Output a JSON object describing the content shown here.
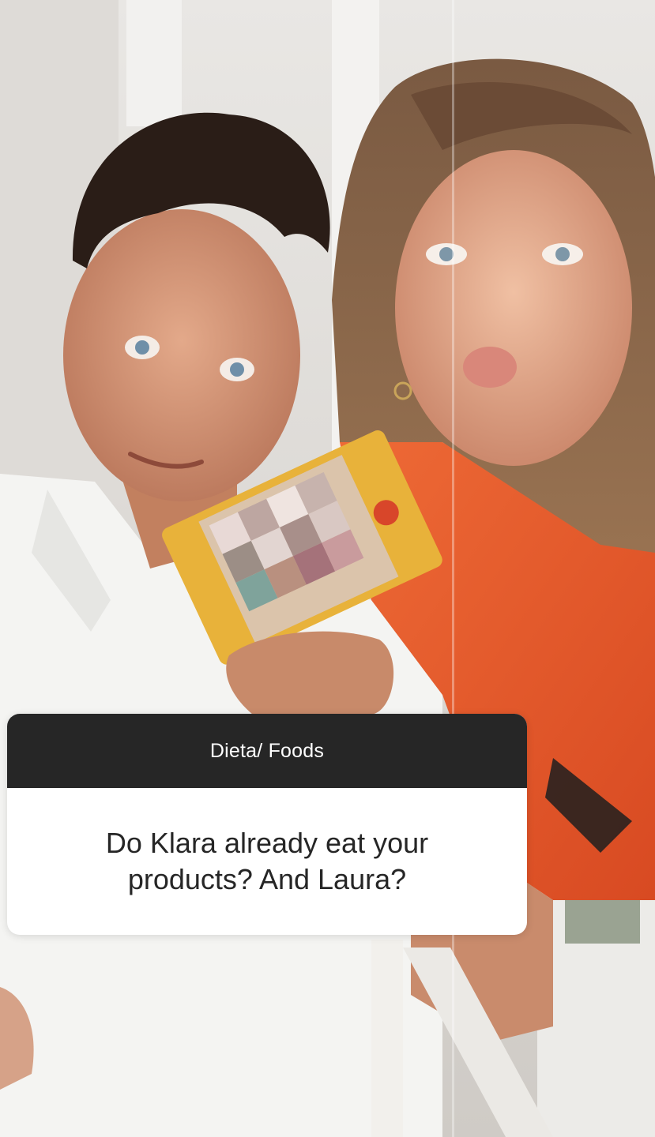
{
  "question_sticker": {
    "header": "Dieta/ Foods",
    "question_line_1": "Do Klara already eat your",
    "question_line_2": "products? And Laura?"
  },
  "photo": {
    "icon": "story-photo",
    "description_hidden": true
  },
  "colors": {
    "card_header": "#262626",
    "card_body": "#ffffff",
    "card_text": "#262626",
    "orange_shirt": "#e5582a",
    "snack_pack": "#e8b23a"
  }
}
